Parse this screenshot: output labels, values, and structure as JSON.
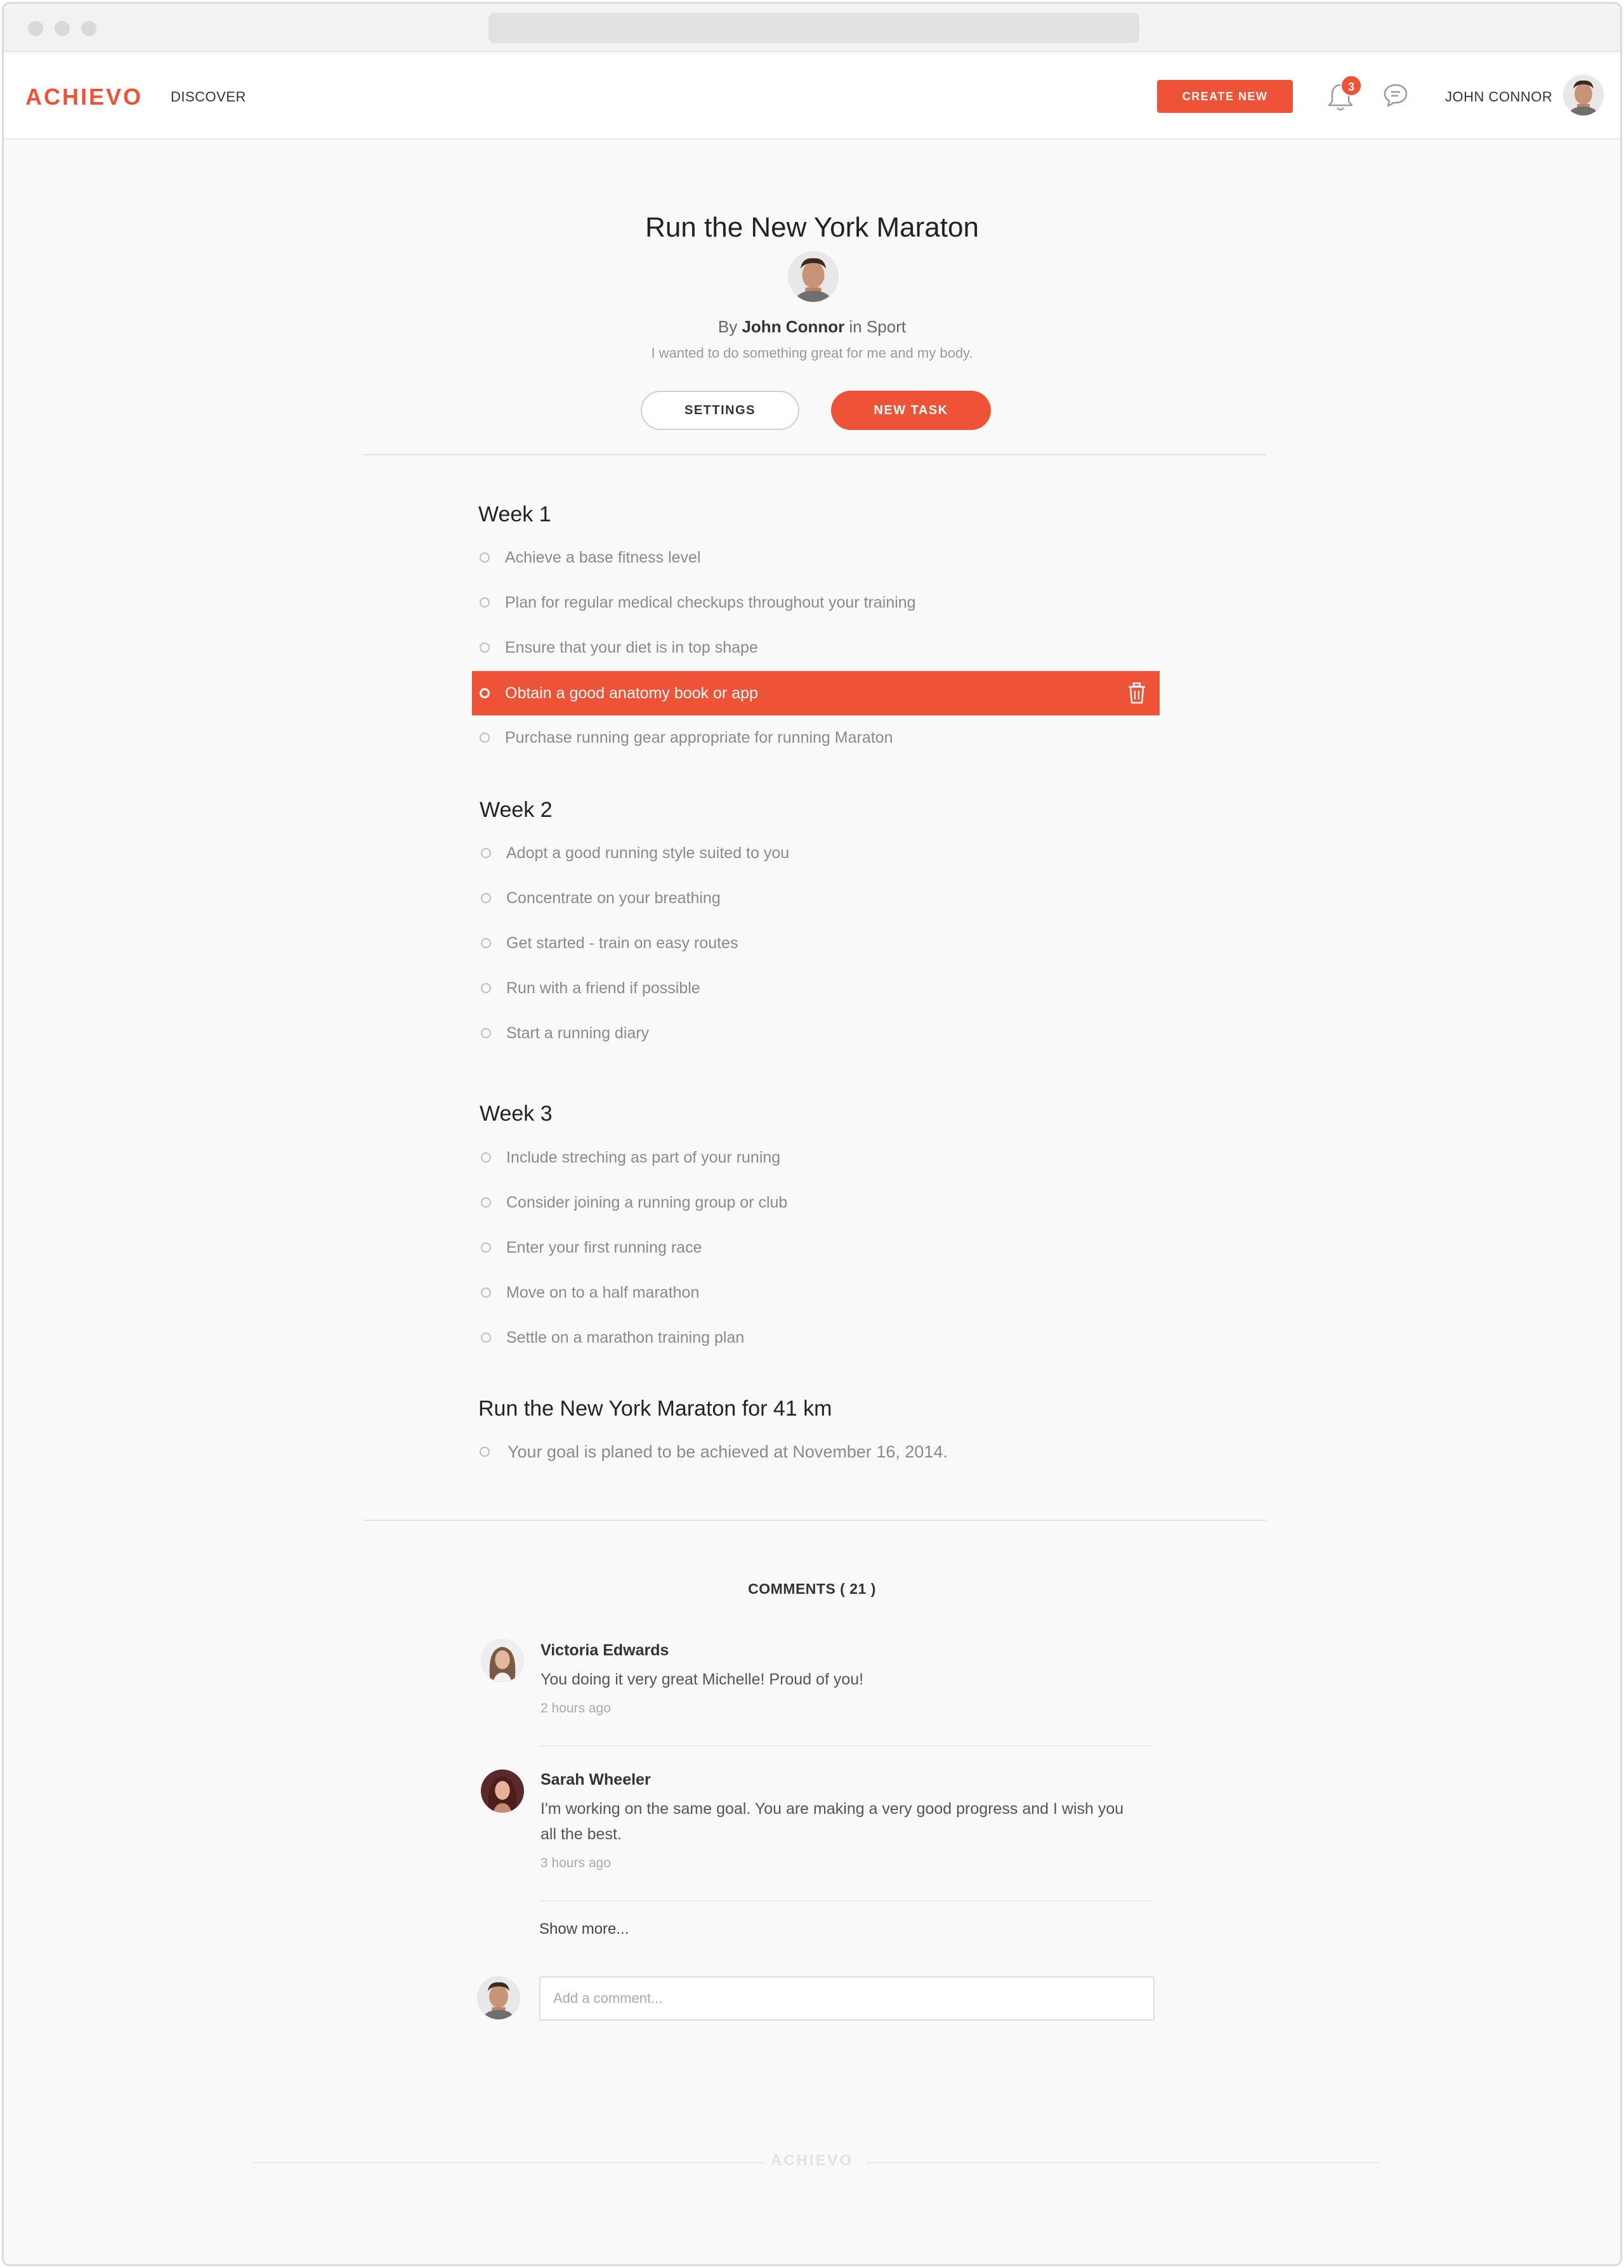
{
  "nav": {
    "logo": "ACHIEVO",
    "discover": "DISCOVER",
    "create_new": "CREATE NEW",
    "notification_count": "3",
    "user_name": "JOHN CONNOR",
    "bell_icon": "bell-icon",
    "chat_icon": "chat-bubble-icon"
  },
  "goal": {
    "title": "Run the New York Maraton",
    "by_prefix": "By",
    "author": "John Connor",
    "in_word": "in",
    "category": "Sport",
    "description": "I wanted to do something great for me and my body.",
    "settings_label": "SETTINGS",
    "new_task_label": "NEW TASK"
  },
  "weeks": [
    {
      "title": "Week 1",
      "tasks": [
        "Achieve a base fitness level",
        "Plan for regular medical checkups throughout your training",
        "Ensure that your diet is in top shape",
        "Obtain a good anatomy book or app",
        "Purchase running gear appropriate for running Maraton"
      ]
    },
    {
      "title": "Week 2",
      "tasks": [
        "Adopt a good running style suited to you",
        "Concentrate on your breathing",
        "Get started - train on easy routes",
        "Run with a friend if possible",
        "Start a running diary"
      ]
    },
    {
      "title": "Week 3",
      "tasks": [
        "Include streching as part of your runing",
        "Consider joining a running group or club",
        "Enter your first running race",
        "Move on to a half marathon",
        "Settle on a marathon training plan"
      ]
    }
  ],
  "final": {
    "title": "Run the New York Maraton for 41 km",
    "note": "Your goal is planed to be achieved at November 16, 2014."
  },
  "comments": {
    "header": "COMMENTS ( 21 )",
    "items": [
      {
        "name": "Victoria Edwards",
        "text": "You doing it very great Michelle! Proud of you!",
        "time": "2 hours ago"
      },
      {
        "name": "Sarah Wheeler",
        "text": "I'm working on the same goal. You are making a very good progress and I wish you all the best.",
        "time": "3 hours ago"
      }
    ],
    "show_more": "Show more...",
    "input_placeholder": "Add a comment..."
  },
  "footer": {
    "logo": "ACHIEVO"
  },
  "colors": {
    "accent": "#ef5337",
    "background": "#f9f9f9"
  }
}
